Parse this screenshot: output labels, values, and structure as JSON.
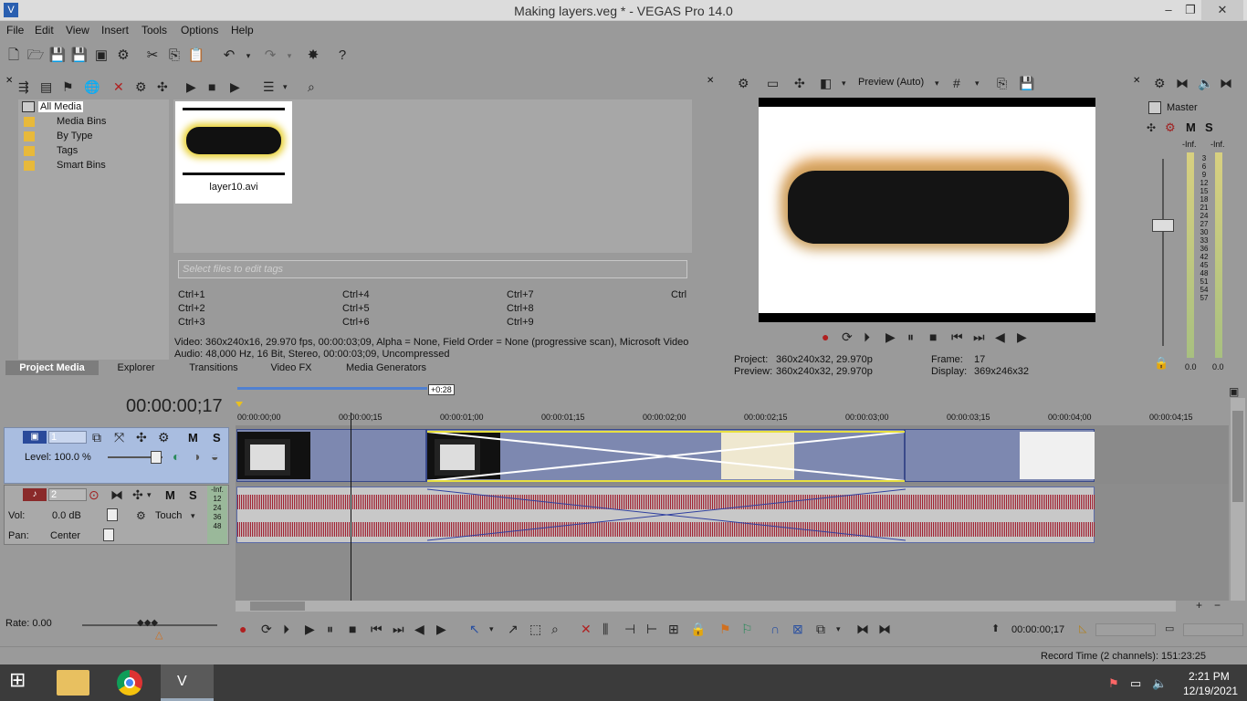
{
  "window": {
    "title": "Making layers.veg * - VEGAS Pro 14.0",
    "min": "–",
    "max": "❐",
    "close": "✕"
  },
  "menu": [
    "File",
    "Edit",
    "View",
    "Insert",
    "Tools",
    "Options",
    "Help"
  ],
  "media": {
    "tree": [
      "All Media",
      "Media Bins",
      "By Type",
      "Tags",
      "Smart Bins"
    ],
    "thumb_label": "layer10.avi",
    "tags_placeholder": "Select files to edit tags",
    "shortcuts": [
      "Ctrl+1",
      "Ctrl+4",
      "Ctrl+7",
      "Ctrl",
      "Ctrl+2",
      "Ctrl+5",
      "Ctrl+8",
      "Ctrl+3",
      "Ctrl+6",
      "Ctrl+9"
    ],
    "video_info": "Video: 360x240x16, 29.970 fps, 00:00:03;09, Alpha = None, Field Order = None (progressive scan), Microsoft Video",
    "audio_info": "Audio: 48,000 Hz, 16 Bit, Stereo, 00:00:03;09, Uncompressed"
  },
  "tabs": [
    "Project Media",
    "Explorer",
    "Transitions",
    "Video FX",
    "Media Generators"
  ],
  "preview": {
    "mode": "Preview (Auto)",
    "project_label": "Project:",
    "project_value": "360x240x32, 29.970p",
    "preview_label": "Preview:",
    "preview_value": "360x240x32, 29.970p",
    "frame_label": "Frame:",
    "frame_value": "17",
    "display_label": "Display:",
    "display_value": "369x246x32"
  },
  "mixer": {
    "title": "Master",
    "inf_left": "-Inf.",
    "inf_right": "-Inf.",
    "scale": [
      "3",
      "6",
      "9",
      "12",
      "15",
      "18",
      "21",
      "24",
      "27",
      "30",
      "33",
      "36",
      "42",
      "45",
      "48",
      "51",
      "54",
      "57"
    ],
    "bottom_left": "0.0",
    "bottom_right": "0.0"
  },
  "timeline": {
    "timecode": "00:00:00;17",
    "marker": "+0:28",
    "ruler": [
      "00:00:00;00",
      "00:00:00;15",
      "00:00:01;00",
      "00:00:01;15",
      "00:00:02;00",
      "00:00:02;15",
      "00:00:03;00",
      "00:00:03;15",
      "00:00:04;00",
      "00:00:04;15"
    ],
    "track1": {
      "num": "1",
      "level": "Level: 100.0 %"
    },
    "track2": {
      "num": "2",
      "vol_label": "Vol:",
      "vol_value": "0.0 dB",
      "touch": "Touch",
      "pan_label": "Pan:",
      "pan_value": "Center",
      "meter": [
        "-Inf.",
        "12",
        "24",
        "36",
        "48"
      ]
    },
    "rate": "Rate: 0.00",
    "cursor_time": "00:00:00;17",
    "record_time": "Record Time (2 channels): 151:23:25"
  },
  "taskbar": {
    "time": "2:21 PM",
    "date": "12/19/2021"
  }
}
